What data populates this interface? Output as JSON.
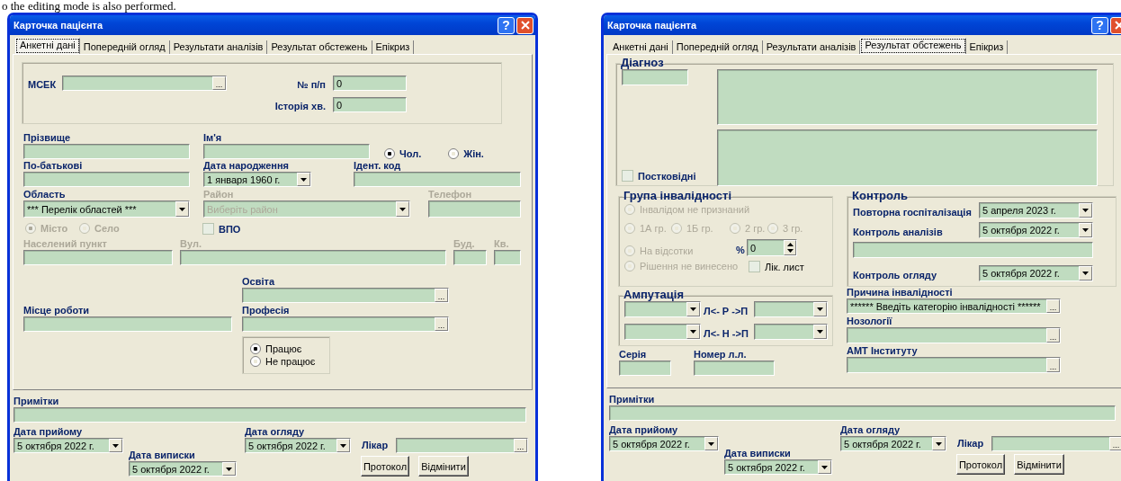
{
  "page_text": "o the editing mode is also performed.",
  "windows": [
    {
      "kind": "personal",
      "title": "Карточка пацієнта",
      "help_button": "?",
      "tabs": [
        {
          "label": "Анкетні дані",
          "selected": true
        },
        {
          "label": "Попередній огляд",
          "selected": false
        },
        {
          "label": "Результати аналізів",
          "selected": false
        },
        {
          "label": "Результат обстежень",
          "selected": false
        },
        {
          "label": "Епікриз",
          "selected": false
        }
      ],
      "mcek": {
        "label": "МСЕК",
        "button": "..."
      },
      "number": {
        "label": "№ п/п",
        "value": "0"
      },
      "history": {
        "label": "Історія хв.",
        "value": "0"
      },
      "surname": {
        "label": "Прізвище"
      },
      "name": {
        "label": "Ім'я"
      },
      "sex": [
        {
          "label": "Чол.",
          "selected": true
        },
        {
          "label": "Жін.",
          "selected": false
        }
      ],
      "patronymic": {
        "label": "По-батькові"
      },
      "birth_date": {
        "label": "Дата народження",
        "value": "1  января  1960 г."
      },
      "id_code": {
        "label": "Ідент. код"
      },
      "region": {
        "label": "Область",
        "value": "*** Перелік областей ***",
        "disabled": false
      },
      "district": {
        "label": "Район",
        "value": "Виберіть район",
        "disabled": true
      },
      "phone": {
        "label": "Телефон",
        "disabled": true
      },
      "settlement_type": {
        "disabled": true,
        "options": [
          {
            "label": "Місто",
            "selected": true
          },
          {
            "label": "Село",
            "selected": false
          }
        ]
      },
      "idp": {
        "label": "ВПО",
        "checked": false
      },
      "address": [
        {
          "label": "Населений пункт",
          "disabled": true
        },
        {
          "label": "Вул.",
          "disabled": true
        },
        {
          "label": "Буд.",
          "disabled": true
        },
        {
          "label": "Кв.",
          "disabled": true
        }
      ],
      "education": {
        "label": "Освіта",
        "button": "..."
      },
      "workplace": {
        "label": "Місце роботи"
      },
      "profession": {
        "label": "Професія",
        "button": "..."
      },
      "employment": [
        {
          "label": "Працює",
          "selected": true
        },
        {
          "label": "Не працює",
          "selected": false
        }
      ],
      "footer": {
        "notes": {
          "label": "Примітки"
        },
        "admission": {
          "label": "Дата прийому",
          "value": "5  октября  2022 г."
        },
        "exam": {
          "label": "Дата огляду",
          "value": "5  октября  2022 г."
        },
        "doctor": {
          "label": "Лікар",
          "button": "..."
        },
        "discharge": {
          "label": "Дата виписки",
          "value": "5  октября  2022 г."
        },
        "buttons": [
          "Протокол",
          "Відмінити"
        ]
      }
    },
    {
      "kind": "results",
      "title": "Карточка пацієнта",
      "help_button": "?",
      "tabs": [
        {
          "label": "Анкетні дані",
          "selected": false
        },
        {
          "label": "Попередній огляд",
          "selected": false
        },
        {
          "label": "Результати аналізів",
          "selected": false
        },
        {
          "label": "Результат обстежень",
          "selected": true
        },
        {
          "label": "Епікриз",
          "selected": false
        }
      ],
      "diagnosis": {
        "title": "Діагноз"
      },
      "post_covid": {
        "label": "Постковідні",
        "checked": false
      },
      "disability_group": {
        "title": "Група інвалідності",
        "options": [
          {
            "label": "Інвалідом не признаний",
            "selected": false
          },
          {
            "label": "1А гр.",
            "selected": false
          },
          {
            "label": "1Б гр.",
            "selected": false
          },
          {
            "label": "2 гр.",
            "selected": false
          },
          {
            "label": "3 гр.",
            "selected": false
          },
          {
            "label": "На відсотки",
            "selected": false
          },
          {
            "label": "Рішення не винесено",
            "selected": false
          }
        ],
        "percent": {
          "label": "%",
          "value": "0"
        },
        "sick_leave": {
          "label": "Лік. лист",
          "checked": false
        }
      },
      "control": {
        "title": "Контроль",
        "rehospitalization": {
          "label": "Повторна госпіталізація",
          "value": "5  апреля  2023 г."
        },
        "tests": {
          "label": "Контроль аналізів",
          "value": "5  октября  2022 г."
        },
        "exam": {
          "label": "Контроль огляду",
          "value": "5  октября  2022 г."
        }
      },
      "amputation": {
        "title": "Ампутація",
        "rows": [
          {
            "label": "Л<- Р ->П"
          },
          {
            "label": "Л<- Н ->П"
          }
        ]
      },
      "series": {
        "label": "Серія"
      },
      "sheet_number": {
        "label": "Номер л.л."
      },
      "cause": {
        "label": "Причина інвалідності",
        "value": "****** Введіть категорію інвалідності ******",
        "button": "..."
      },
      "nosology": {
        "label": "Нозології",
        "button": "..."
      },
      "institute": {
        "label": "АМТ Інституту",
        "button": "..."
      },
      "footer": {
        "notes": {
          "label": "Примітки"
        },
        "admission": {
          "label": "Дата прийому",
          "value": "5  октября  2022 г."
        },
        "exam": {
          "label": "Дата огляду",
          "value": "5  октября  2022 г."
        },
        "doctor": {
          "label": "Лікар",
          "button": "..."
        },
        "discharge": {
          "label": "Дата виписки",
          "value": "5  октября  2022 г."
        },
        "buttons": [
          "Протокол",
          "Відмінити"
        ]
      }
    }
  ]
}
